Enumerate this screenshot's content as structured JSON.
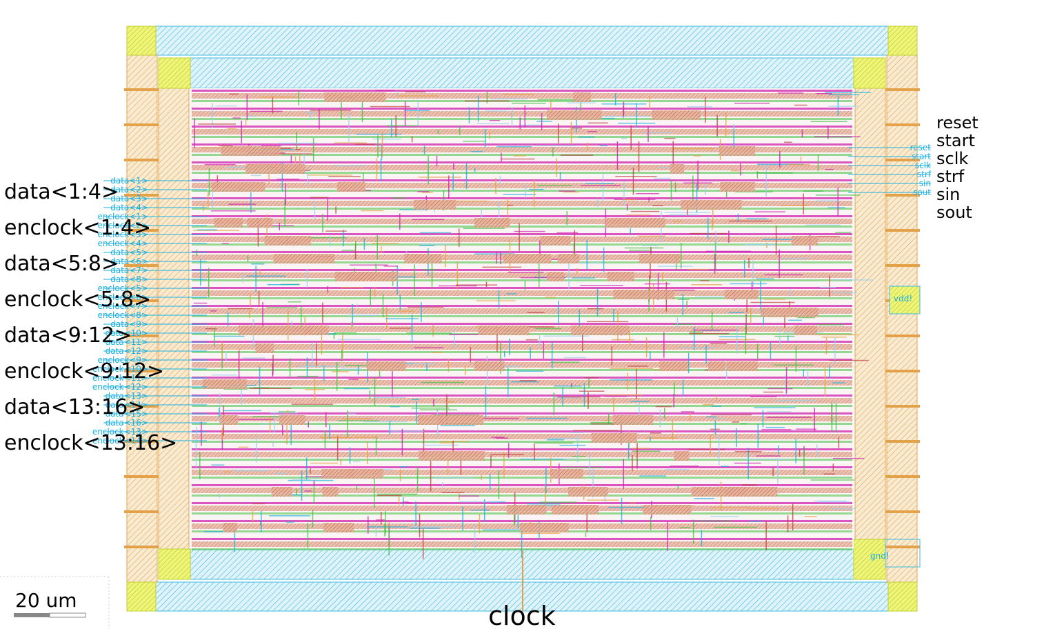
{
  "left_pins": [
    "data<1:4>",
    "enclock<1:4>",
    "data<5:8>",
    "enclock<5:8>",
    "data<9:12>",
    "enclock<9:12>",
    "data<13:16>",
    "enclock<13:16>"
  ],
  "left_tiny_labels": [
    "data<1>",
    "data<2>",
    "data<3>",
    "data<4>",
    "enclock<1>",
    "enclock<2>",
    "enclock<3>",
    "enclock<4>",
    "data<5>",
    "data<6>",
    "data<7>",
    "data<8>",
    "enclock<5>",
    "enclock<6>",
    "enclock<7>",
    "enclock<8>",
    "data<9>",
    "data<10>",
    "data<11>",
    "data<12>",
    "enclock<9>",
    "enclock<10>",
    "enclock<11>",
    "enclock<12>",
    "data<13>",
    "data<14>",
    "data<15>",
    "data<16>",
    "enclock<13>",
    "enclock<14>"
  ],
  "right_pins": [
    "reset",
    "start",
    "sclk",
    "strf",
    "sin",
    "sout"
  ],
  "right_tiny_labels": [
    "reset",
    "start",
    "sclk",
    "strf",
    "sin",
    "sout"
  ],
  "bottom_pin": "clock",
  "power_labels": {
    "vdd": "vdd!",
    "gnd": "gnd!"
  },
  "scale_bar": {
    "label": "20 um"
  },
  "colors": {
    "metal_cyan": "#1ab0e0",
    "pad_yellow": "#e6f23c",
    "metal_orange": "#e8a040",
    "poly_red": "#c04040",
    "via_magenta": "#d020b0",
    "green": "#40c040",
    "ring_fill": "#bfe6f2"
  }
}
